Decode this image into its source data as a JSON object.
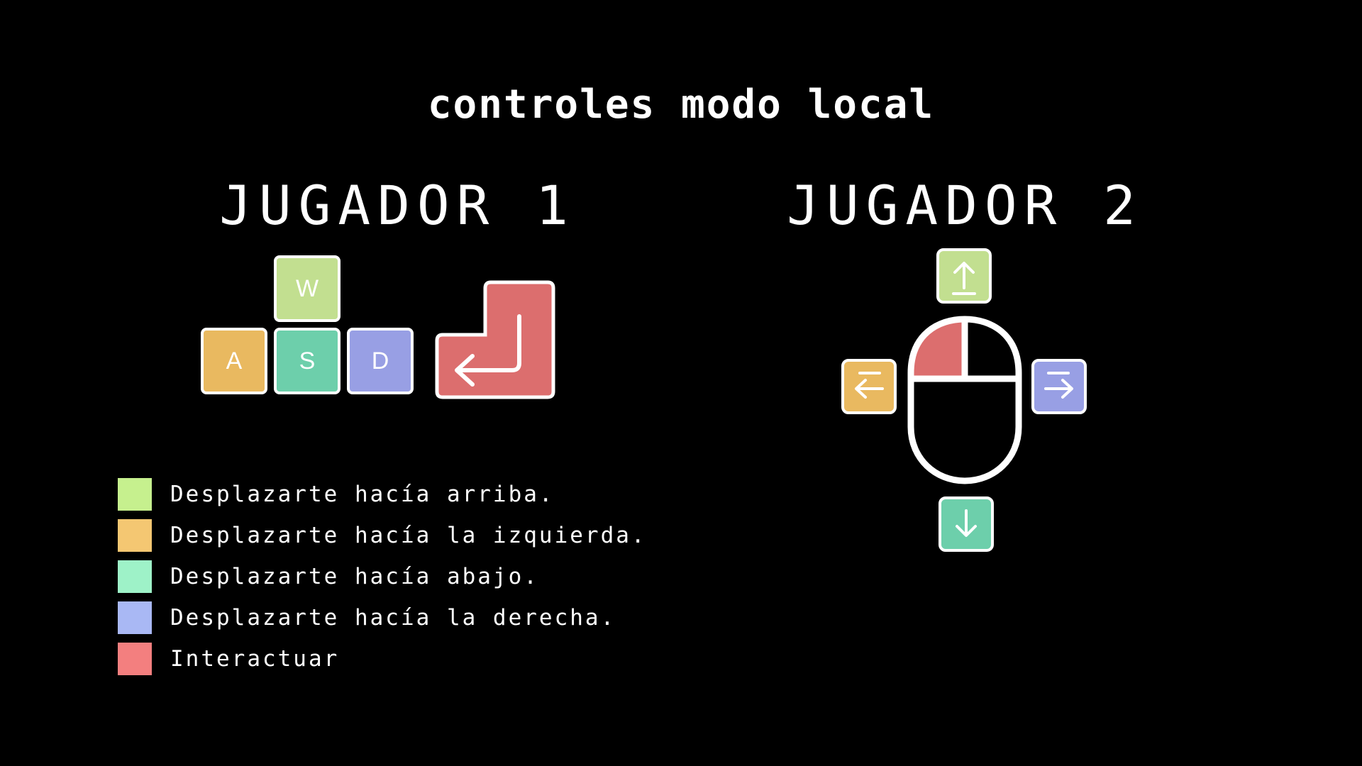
{
  "screen": {
    "title": "Controles Modo local",
    "background_color": "#000000"
  },
  "player1": {
    "title": "JUGADOR 1",
    "keys": [
      {
        "label": "W",
        "color": "#c2df90",
        "action": "up"
      },
      {
        "label": "A",
        "color": "#e9b960",
        "action": "left"
      },
      {
        "label": "S",
        "color": "#6dcfab",
        "action": "down"
      },
      {
        "label": "D",
        "color": "#989fe4",
        "action": "right"
      }
    ],
    "interact_key": {
      "icon": "enter-key-icon",
      "color": "#dc6e6e"
    }
  },
  "player2": {
    "title": "JUGADOR 2",
    "arrows": [
      {
        "icon": "arrow-up-icon",
        "color": "#c2df90"
      },
      {
        "icon": "arrow-left-icon",
        "color": "#e9b960"
      },
      {
        "icon": "arrow-right-icon",
        "color": "#989fe4"
      },
      {
        "icon": "arrow-down-icon",
        "color": "#6dcfab"
      }
    ],
    "mouse": {
      "icon": "mouse-icon",
      "left_button_color": "#dc6e6e"
    }
  },
  "legend": [
    {
      "color": "#c6f08e",
      "text": "Desplazarte hacía arriba."
    },
    {
      "color": "#f4c772",
      "text": "Desplazarte hacía la izquierda."
    },
    {
      "color": "#9ef2c8",
      "text": "Desplazarte hacía abajo."
    },
    {
      "color": "#a9b8f4",
      "text": "Desplazarte hacía la derecha."
    },
    {
      "color": "#f37f7f",
      "text": "Interactuar"
    }
  ]
}
